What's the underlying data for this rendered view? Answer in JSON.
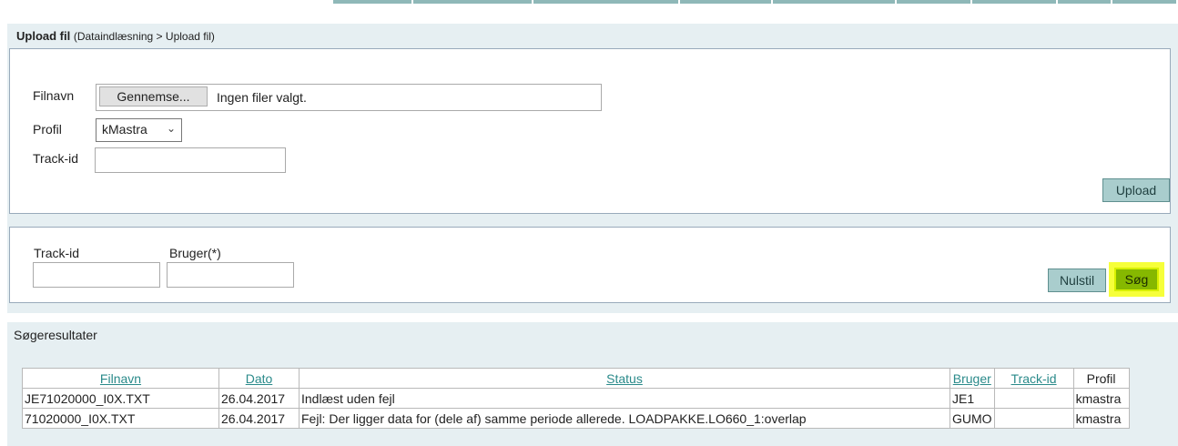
{
  "upload_panel": {
    "title": "Upload fil",
    "breadcrumb": "(Dataindlæsning > Upload fil)",
    "filename_label": "Filnavn",
    "browse_button": "Gennemse...",
    "no_file_text": "Ingen filer valgt.",
    "profile_label": "Profil",
    "profile_value": "kMastra",
    "trackid_label": "Track-id",
    "trackid_value": "",
    "upload_button": "Upload"
  },
  "search_panel": {
    "trackid_label": "Track-id",
    "user_label": "Bruger(*)",
    "trackid_value": "",
    "user_value": "",
    "reset_button": "Nulstil",
    "search_button": "Søg"
  },
  "results": {
    "title": "Søgeresultater",
    "columns": [
      "Filnavn",
      "Dato",
      "Status",
      "Bruger",
      "Track-id",
      "Profil"
    ],
    "rows": [
      [
        "JE71020000_I0X.TXT",
        "26.04.2017",
        "Indlæst uden fejl",
        "JE1",
        "",
        "kmastra"
      ],
      [
        "71020000_I0X.TXT",
        "26.04.2017",
        "Fejl: Der ligger data for (dele af) samme periode allerede. LOADPAKKE.LO660_1:overlap",
        "GUMO",
        "",
        "kmastra"
      ]
    ]
  }
}
